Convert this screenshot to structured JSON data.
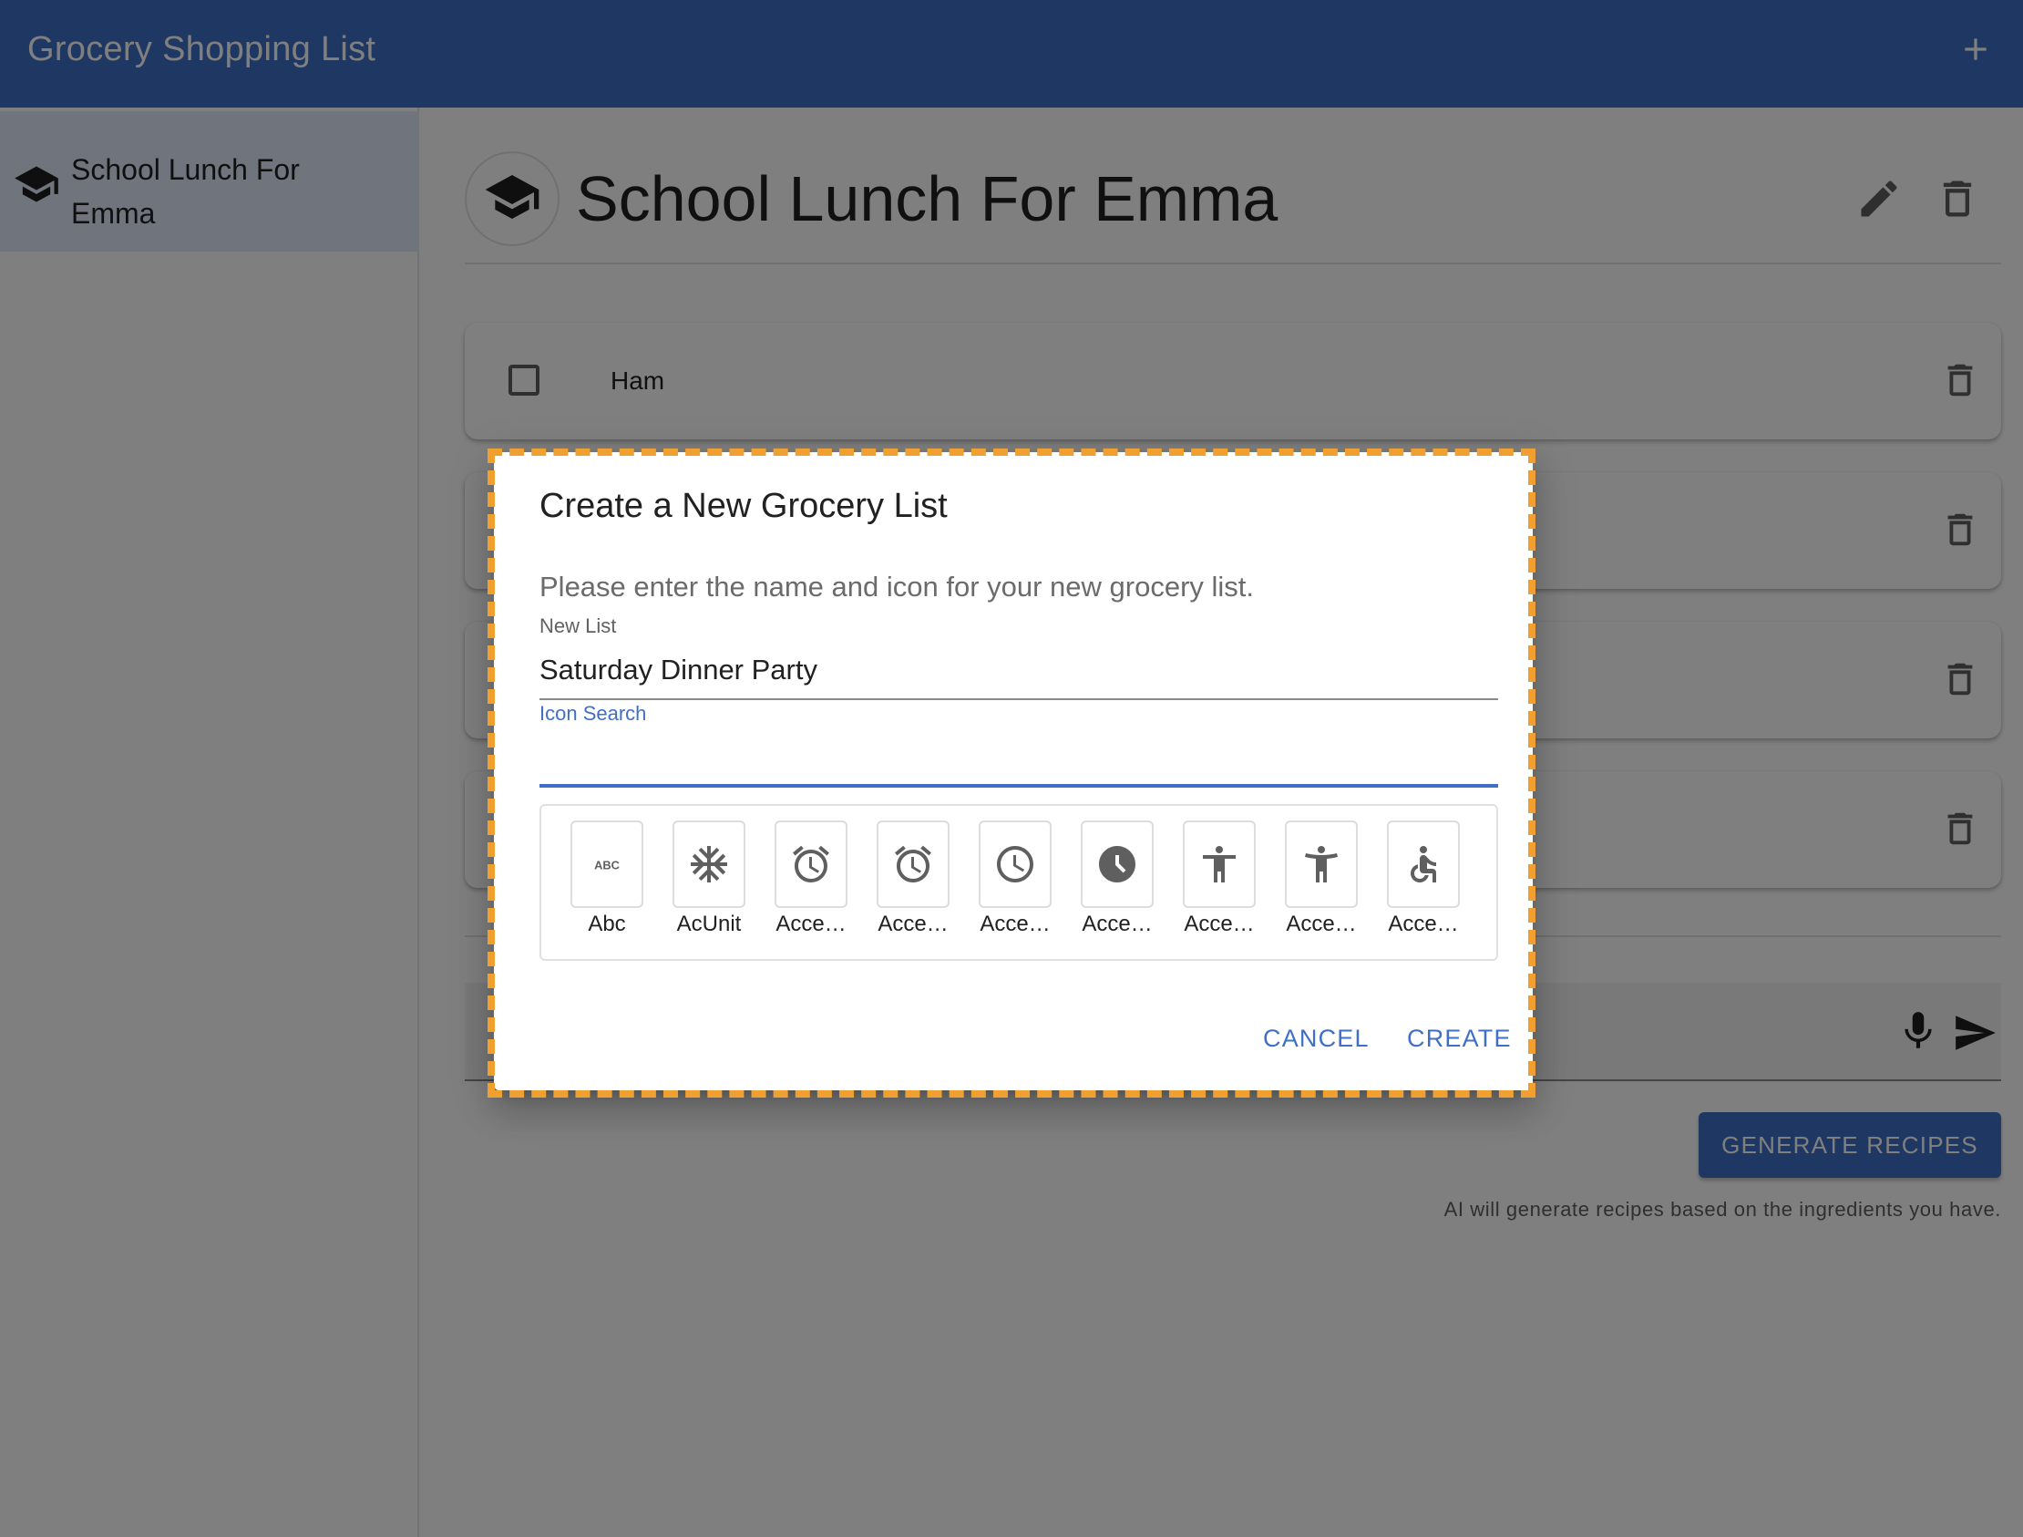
{
  "app": {
    "title": "Grocery Shopping List",
    "add_icon": "plus-icon"
  },
  "colors": {
    "primary": "#3f6fc6",
    "focus_outline": "#f0a030",
    "selected_bg": "#e1ebfa"
  },
  "sidebar": {
    "items": [
      {
        "label": "School Lunch For Emma",
        "icon": "school-icon",
        "selected": true
      }
    ]
  },
  "main": {
    "title": "School Lunch For Emma",
    "title_icon": "school-icon",
    "items": [
      {
        "label": "Ham",
        "checked": false
      },
      {
        "label": "",
        "checked": false
      },
      {
        "label": "",
        "checked": false
      },
      {
        "label": "",
        "checked": false
      }
    ],
    "generate_button": "Generate Recipes",
    "generate_note": "AI will generate recipes based on the ingredients you have."
  },
  "dialog": {
    "title": "Create a New Grocery List",
    "description": "Please enter the name and icon for your new grocery list.",
    "name_label": "New List",
    "name_value": "Saturday Dinner Party",
    "search_label": "Icon Search",
    "search_value": "",
    "icons": [
      {
        "label": "Abc",
        "icon": "abc-icon"
      },
      {
        "label": "AcUnit",
        "icon": "ac-unit-icon"
      },
      {
        "label": "Acce…",
        "icon": "access-alarm-icon"
      },
      {
        "label": "Acce…",
        "icon": "access-alarms-icon"
      },
      {
        "label": "Acce…",
        "icon": "access-time-icon"
      },
      {
        "label": "Acce…",
        "icon": "access-time-filled-icon"
      },
      {
        "label": "Acce…",
        "icon": "accessibility-icon"
      },
      {
        "label": "Acce…",
        "icon": "accessibility-new-icon"
      },
      {
        "label": "Acce…",
        "icon": "accessible-icon"
      }
    ],
    "cancel_label": "Cancel",
    "create_label": "Create"
  }
}
